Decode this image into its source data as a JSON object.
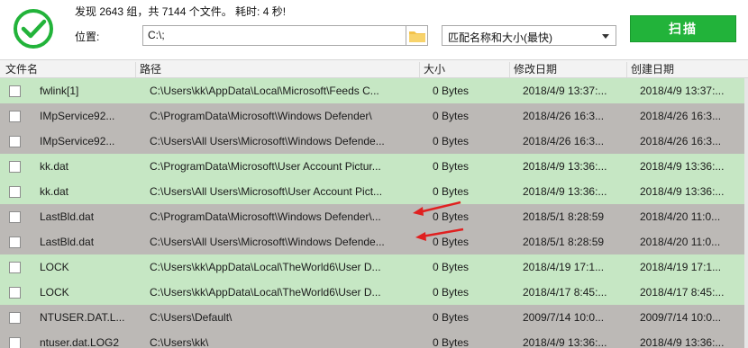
{
  "summary": "发现 2643 组，共 7144 个文件。 耗时: 4 秒!",
  "location_label": "位置:",
  "path_value": "C:\\;",
  "match_mode": "匹配名称和大小(最快)",
  "scan_label": "扫描",
  "columns": {
    "name": "文件名",
    "path": "路径",
    "size": "大小",
    "modified": "修改日期",
    "created": "创建日期"
  },
  "rows": [
    {
      "name": "fwlink[1]",
      "path": "C:\\Users\\kk\\AppData\\Local\\Microsoft\\Feeds C...",
      "size": "0 Bytes",
      "modified": "2018/4/9 13:37:...",
      "created": "2018/4/9 13:37:...",
      "tone": "green"
    },
    {
      "name": "IMpService92...",
      "path": "C:\\ProgramData\\Microsoft\\Windows Defender\\",
      "size": "0 Bytes",
      "modified": "2018/4/26 16:3...",
      "created": "2018/4/26 16:3...",
      "tone": "gray"
    },
    {
      "name": "IMpService92...",
      "path": "C:\\Users\\All Users\\Microsoft\\Windows Defende...",
      "size": "0 Bytes",
      "modified": "2018/4/26 16:3...",
      "created": "2018/4/26 16:3...",
      "tone": "gray"
    },
    {
      "name": "kk.dat",
      "path": "C:\\ProgramData\\Microsoft\\User Account Pictur...",
      "size": "0 Bytes",
      "modified": "2018/4/9 13:36:...",
      "created": "2018/4/9 13:36:...",
      "tone": "green"
    },
    {
      "name": "kk.dat",
      "path": "C:\\Users\\All Users\\Microsoft\\User Account Pict...",
      "size": "0 Bytes",
      "modified": "2018/4/9 13:36:...",
      "created": "2018/4/9 13:36:...",
      "tone": "green"
    },
    {
      "name": "LastBld.dat",
      "path": "C:\\ProgramData\\Microsoft\\Windows Defender\\...",
      "size": "0 Bytes",
      "modified": "2018/5/1 8:28:59",
      "created": "2018/4/20 11:0...",
      "tone": "gray"
    },
    {
      "name": "LastBld.dat",
      "path": "C:\\Users\\All Users\\Microsoft\\Windows Defende...",
      "size": "0 Bytes",
      "modified": "2018/5/1 8:28:59",
      "created": "2018/4/20 11:0...",
      "tone": "gray"
    },
    {
      "name": "LOCK",
      "path": "C:\\Users\\kk\\AppData\\Local\\TheWorld6\\User D...",
      "size": "0 Bytes",
      "modified": "2018/4/19 17:1...",
      "created": "2018/4/19 17:1...",
      "tone": "green"
    },
    {
      "name": "LOCK",
      "path": "C:\\Users\\kk\\AppData\\Local\\TheWorld6\\User D...",
      "size": "0 Bytes",
      "modified": "2018/4/17 8:45:...",
      "created": "2018/4/17 8:45:...",
      "tone": "green"
    },
    {
      "name": "NTUSER.DAT.L...",
      "path": "C:\\Users\\Default\\",
      "size": "0 Bytes",
      "modified": "2009/7/14 10:0...",
      "created": "2009/7/14 10:0...",
      "tone": "gray"
    },
    {
      "name": "ntuser.dat.LOG2",
      "path": "C:\\Users\\kk\\",
      "size": "0 Bytes",
      "modified": "2018/4/9 13:36:...",
      "created": "2018/4/9 13:36:...",
      "tone": "gray"
    }
  ],
  "colors": {
    "accent": "#22b33a",
    "row_green": "#c6e7c4",
    "row_gray": "#bcb9b6",
    "arrow": "#e02020"
  },
  "icons": [
    "check-icon",
    "folder-icon",
    "chevron-down-icon",
    "red-arrow-icon"
  ]
}
